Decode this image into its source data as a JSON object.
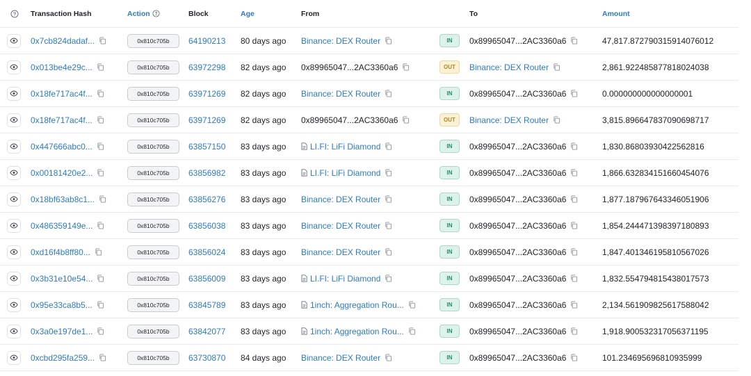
{
  "headers": {
    "info_icon": "question-circle-icon",
    "hash": "Transaction Hash",
    "action": "Action",
    "block": "Block",
    "age": "Age",
    "from": "From",
    "to": "To",
    "amount": "Amount"
  },
  "colors": {
    "link": "#2d7bc4",
    "in": "#1f8f6a",
    "out": "#b5851c"
  },
  "rows": [
    {
      "hash": "0x7cb824dadaf...",
      "method": "0x810c705b",
      "block": "64190213",
      "age": "80 days ago",
      "from": "Binance: DEX Router",
      "from_link": true,
      "from_doc": false,
      "dir": "IN",
      "to": "0x89965047...2AC3360a6",
      "to_link": false,
      "amount": "47,817.872790315914076012"
    },
    {
      "hash": "0x013be4e29c...",
      "method": "0x810c705b",
      "block": "63972298",
      "age": "82 days ago",
      "from": "0x89965047...2AC3360a6",
      "from_link": false,
      "from_doc": false,
      "dir": "OUT",
      "to": "Binance: DEX Router",
      "to_link": true,
      "amount": "2,861.922485877818024038"
    },
    {
      "hash": "0x18fe717ac4f...",
      "method": "0x810c705b",
      "block": "63971269",
      "age": "82 days ago",
      "from": "Binance: DEX Router",
      "from_link": true,
      "from_doc": false,
      "dir": "IN",
      "to": "0x89965047...2AC3360a6",
      "to_link": false,
      "amount": "0.000000000000000001"
    },
    {
      "hash": "0x18fe717ac4f...",
      "method": "0x810c705b",
      "block": "63971269",
      "age": "82 days ago",
      "from": "0x89965047...2AC3360a6",
      "from_link": false,
      "from_doc": false,
      "dir": "OUT",
      "to": "Binance: DEX Router",
      "to_link": true,
      "amount": "3,815.896647837090698717"
    },
    {
      "hash": "0x447666abc0...",
      "method": "0x810c705b",
      "block": "63857150",
      "age": "83 days ago",
      "from": "LI.FI: LiFi Diamond",
      "from_link": true,
      "from_doc": true,
      "dir": "IN",
      "to": "0x89965047...2AC3360a6",
      "to_link": false,
      "amount": "1,830.86803930422562816"
    },
    {
      "hash": "0x00181420e2...",
      "method": "0x810c705b",
      "block": "63856982",
      "age": "83 days ago",
      "from": "LI.FI: LiFi Diamond",
      "from_link": true,
      "from_doc": true,
      "dir": "IN",
      "to": "0x89965047...2AC3360a6",
      "to_link": false,
      "amount": "1,866.632834151660454076"
    },
    {
      "hash": "0x18bf63ab8c1...",
      "method": "0x810c705b",
      "block": "63856276",
      "age": "83 days ago",
      "from": "Binance: DEX Router",
      "from_link": true,
      "from_doc": false,
      "dir": "IN",
      "to": "0x89965047...2AC3360a6",
      "to_link": false,
      "amount": "1,877.187967643346051906"
    },
    {
      "hash": "0x486359149e...",
      "method": "0x810c705b",
      "block": "63856038",
      "age": "83 days ago",
      "from": "Binance: DEX Router",
      "from_link": true,
      "from_doc": false,
      "dir": "IN",
      "to": "0x89965047...2AC3360a6",
      "to_link": false,
      "amount": "1,854.244471398397180893"
    },
    {
      "hash": "0xd16f4b8ff80...",
      "method": "0x810c705b",
      "block": "63856024",
      "age": "83 days ago",
      "from": "Binance: DEX Router",
      "from_link": true,
      "from_doc": false,
      "dir": "IN",
      "to": "0x89965047...2AC3360a6",
      "to_link": false,
      "amount": "1,847.401346195810567026"
    },
    {
      "hash": "0x3b31e10e54...",
      "method": "0x810c705b",
      "block": "63856009",
      "age": "83 days ago",
      "from": "LI.FI: LiFi Diamond",
      "from_link": true,
      "from_doc": true,
      "dir": "IN",
      "to": "0x89965047...2AC3360a6",
      "to_link": false,
      "amount": "1,832.554794815438017573"
    },
    {
      "hash": "0x95e33ca8b5...",
      "method": "0x810c705b",
      "block": "63845789",
      "age": "83 days ago",
      "from": "1inch: Aggregation Rou...",
      "from_link": true,
      "from_doc": true,
      "dir": "IN",
      "to": "0x89965047...2AC3360a6",
      "to_link": false,
      "amount": "2,134.561909825617588042"
    },
    {
      "hash": "0x3a0e197de1...",
      "method": "0x810c705b",
      "block": "63842077",
      "age": "83 days ago",
      "from": "1inch: Aggregation Rou...",
      "from_link": true,
      "from_doc": true,
      "dir": "IN",
      "to": "0x89965047...2AC3360a6",
      "to_link": false,
      "amount": "1,918.900532317056371195"
    },
    {
      "hash": "0xcbd295fa259...",
      "method": "0x810c705b",
      "block": "63730870",
      "age": "84 days ago",
      "from": "Binance: DEX Router",
      "from_link": true,
      "from_doc": false,
      "dir": "IN",
      "to": "0x89965047...2AC3360a6",
      "to_link": false,
      "amount": "101.234695696810935999"
    }
  ]
}
